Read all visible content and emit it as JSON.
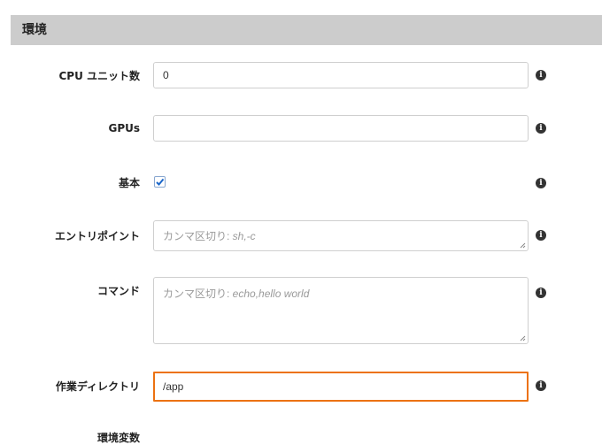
{
  "section": {
    "title": "環境"
  },
  "fields": {
    "cpu": {
      "label": "CPU ユニット数",
      "value": "0"
    },
    "gpus": {
      "label": "GPUs",
      "value": ""
    },
    "essential": {
      "label": "基本",
      "checked": true
    },
    "entrypoint": {
      "label": "エントリポイント",
      "placeholder_jp": "カンマ区切り: ",
      "placeholder_example": "sh,-c"
    },
    "command": {
      "label": "コマンド",
      "placeholder_jp": "カンマ区切り: ",
      "placeholder_example": "echo,hello world"
    },
    "workdir": {
      "label": "作業ディレクトリ",
      "value": "/app"
    },
    "env": {
      "label": "環境変数"
    }
  },
  "info_icon_glyph": "i",
  "colors": {
    "focus": "#ec7211",
    "header_bg": "#cccccc",
    "check": "#1a66c9"
  }
}
